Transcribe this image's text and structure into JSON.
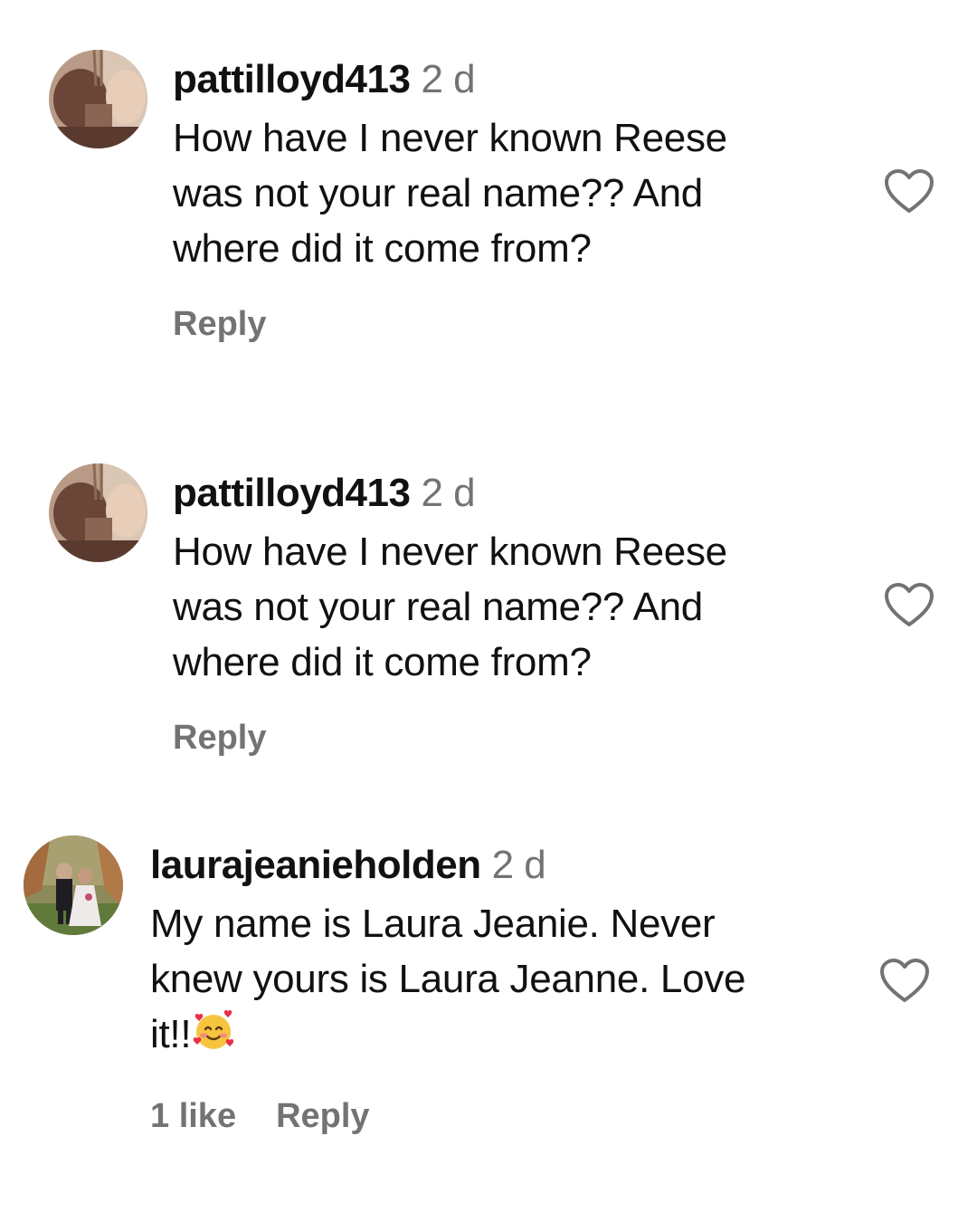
{
  "comments": [
    {
      "username": "pattilloyd413",
      "time": "2 d",
      "text": "How have I never known Reese\nwas not your real name?? And\nwhere did it come from?",
      "reply_label": "Reply"
    },
    {
      "username": "pattilloyd413",
      "time": "2 d",
      "text": "How have I never known Reese\nwas not your real name?? And\nwhere did it come from?",
      "reply_label": "Reply"
    },
    {
      "username": "laurajeanieholden",
      "time": "2 d",
      "text": "My name is Laura Jeanie. Never\nknew yours is Laura Jeanne. Love\nit!!",
      "emoji": "smiling-face-with-hearts",
      "likes_label": "1 like",
      "reply_label": "Reply"
    }
  ],
  "colors": {
    "text": "#111111",
    "secondary": "#737373",
    "heart_outline": "#737373"
  }
}
